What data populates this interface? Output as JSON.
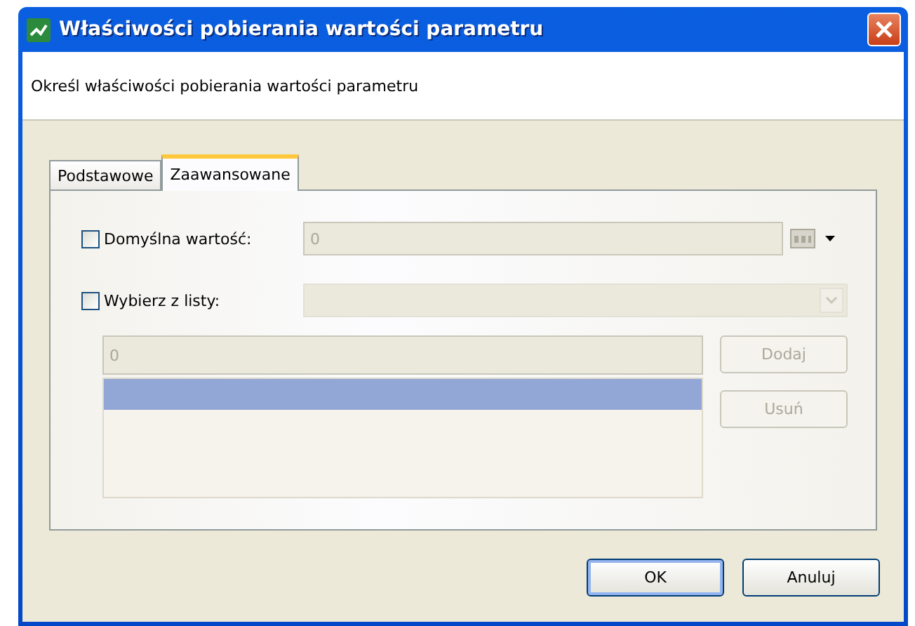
{
  "window": {
    "title": "Właściwości pobierania wartości parametru"
  },
  "header": {
    "text": "Określ właściwości pobierania wartości parametru"
  },
  "tabs": [
    {
      "label": "Podstawowe",
      "selected": false
    },
    {
      "label": "Zaawansowane",
      "selected": true
    }
  ],
  "default_value": {
    "label": "Domyślna wartość:",
    "checked": false,
    "value": "0",
    "disabled": true
  },
  "pick_from_list": {
    "label": "Wybierz z listy:",
    "checked": false,
    "disabled": true
  },
  "list_editor": {
    "input_value": "0",
    "disabled": true,
    "rows": [
      {
        "selected": true
      }
    ],
    "buttons": [
      {
        "label": "Dodaj",
        "disabled": true
      },
      {
        "label": "Usuń",
        "disabled": true
      }
    ]
  },
  "buttons": [
    {
      "label": "OK",
      "default": true
    },
    {
      "label": "Anuluj",
      "default": false
    }
  ]
}
